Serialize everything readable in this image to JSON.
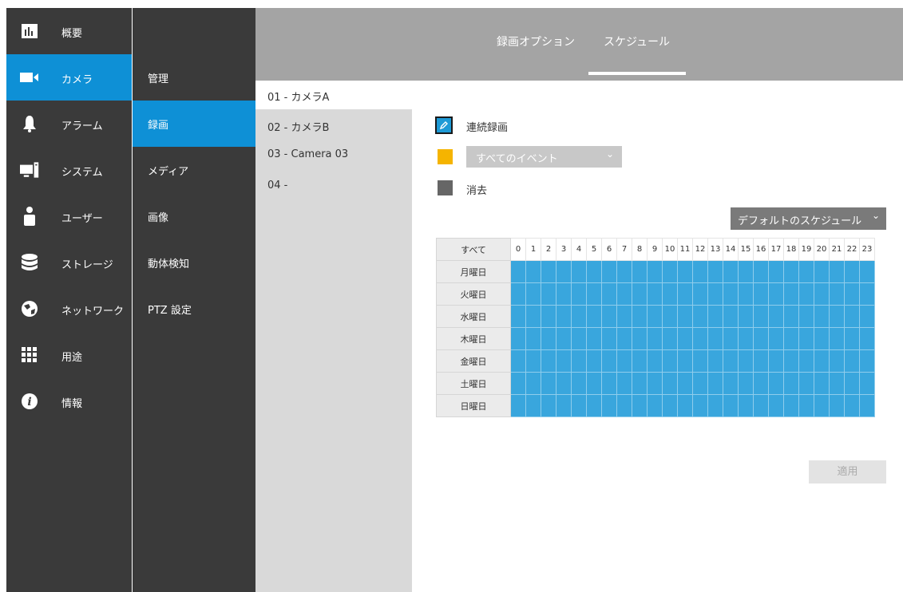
{
  "main_nav": [
    {
      "label": "概要",
      "icon": "chart-icon"
    },
    {
      "label": "カメラ",
      "icon": "camera-icon",
      "active": true
    },
    {
      "label": "アラーム",
      "icon": "bell-icon"
    },
    {
      "label": "システム",
      "icon": "computer-icon"
    },
    {
      "label": "ユーザー",
      "icon": "user-icon"
    },
    {
      "label": "ストレージ",
      "icon": "storage-icon"
    },
    {
      "label": "ネットワーク",
      "icon": "globe-icon"
    },
    {
      "label": "用途",
      "icon": "grid-icon"
    },
    {
      "label": "情報",
      "icon": "info-icon"
    }
  ],
  "sub_nav": [
    {
      "label": "管理"
    },
    {
      "label": "録画",
      "active": true
    },
    {
      "label": "メディア"
    },
    {
      "label": "画像"
    },
    {
      "label": "動体検知"
    },
    {
      "label": "PTZ 設定"
    }
  ],
  "cameras": [
    {
      "label": "01 - カメラA",
      "active": true
    },
    {
      "label": "02 - カメラB"
    },
    {
      "label": "03 - Camera 03"
    },
    {
      "label": "04 -"
    }
  ],
  "header": {
    "tabs": [
      {
        "label": "録画オプション"
      },
      {
        "label": "スケジュール",
        "active": true
      }
    ]
  },
  "legend": {
    "continuous": "連続録画",
    "event_select": "すべてのイベント",
    "erase": "消去"
  },
  "default_schedule_label": "デフォルトのスケジュール",
  "schedule": {
    "all_label": "すべて",
    "hours": [
      "0",
      "1",
      "2",
      "3",
      "4",
      "5",
      "6",
      "7",
      "8",
      "9",
      "10",
      "11",
      "12",
      "13",
      "14",
      "15",
      "16",
      "17",
      "18",
      "19",
      "20",
      "21",
      "22",
      "23"
    ],
    "days": [
      "月曜日",
      "火曜日",
      "水曜日",
      "木曜日",
      "金曜日",
      "土曜日",
      "日曜日"
    ]
  },
  "apply_label": "適用",
  "colors": {
    "accent": "#0e90d6",
    "schedule_fill": "#39a6dd",
    "event_color": "#f5b400",
    "erase_color": "#666666"
  }
}
